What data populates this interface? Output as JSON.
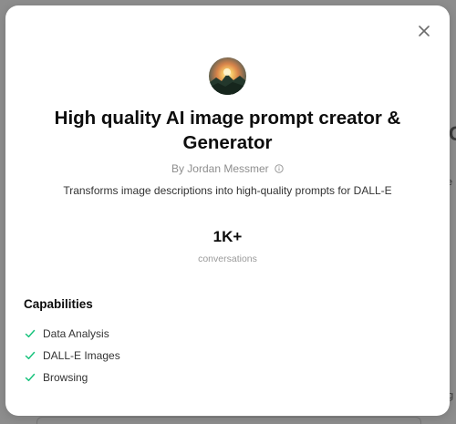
{
  "background": {
    "glyph_large": "C",
    "glyph_small1": "e",
    "glyph_small2": "g"
  },
  "modal": {
    "close_icon": "close-icon",
    "avatar_icon": "gpt-avatar-image",
    "title": "High quality AI image prompt creator & Generator",
    "author": "By Jordan Messmer",
    "author_info_icon": "info-icon",
    "description": "Transforms image descriptions into high-quality prompts for DALL-E",
    "stats": {
      "value": "1K+",
      "label": "conversations"
    },
    "capabilities": {
      "heading": "Capabilities",
      "check_icon": "check-icon",
      "check_color": "#19c37d",
      "items": [
        {
          "label": "Data Analysis"
        },
        {
          "label": "DALL-E Images"
        },
        {
          "label": "Browsing"
        }
      ]
    }
  }
}
